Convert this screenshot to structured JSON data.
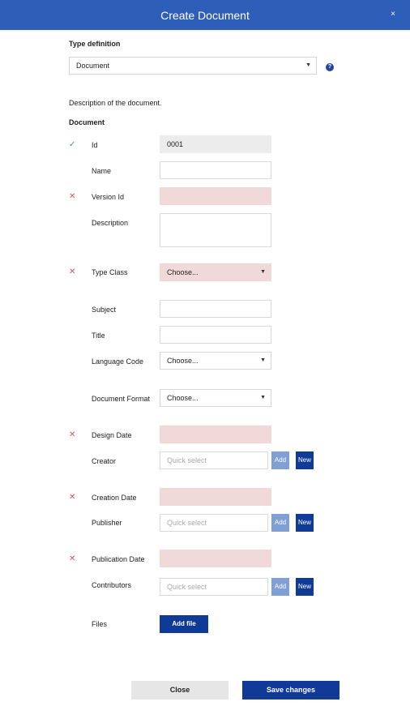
{
  "dialog": {
    "title": "Create Document",
    "close_glyph": "×"
  },
  "type_definition": {
    "label": "Type definition",
    "selected": "Document",
    "help_glyph": "?"
  },
  "description_text": "Description of the document.",
  "section_title": "Document",
  "fields": {
    "id": {
      "label": "Id",
      "value": "0001",
      "status": "valid",
      "status_glyph": "✓"
    },
    "name": {
      "label": "Name",
      "value": ""
    },
    "version_id": {
      "label": "Version Id",
      "value": "",
      "status": "invalid",
      "status_glyph": "✕"
    },
    "description": {
      "label": "Description",
      "value": ""
    },
    "type_class": {
      "label": "Type Class",
      "selected": "Choose...",
      "status": "invalid",
      "status_glyph": "✕"
    },
    "subject": {
      "label": "Subject",
      "value": ""
    },
    "title": {
      "label": "Title",
      "value": ""
    },
    "language_code": {
      "label": "Language Code",
      "selected": "Choose..."
    },
    "document_format": {
      "label": "Document Format",
      "selected": "Choose..."
    },
    "design_date": {
      "label": "Design Date",
      "value": "",
      "status": "invalid",
      "status_glyph": "✕"
    },
    "creator": {
      "label": "Creator",
      "placeholder": "Quick select",
      "add_label": "Add",
      "new_label": "New"
    },
    "creation_date": {
      "label": "Creation Date",
      "value": "",
      "status": "invalid",
      "status_glyph": "✕"
    },
    "publisher": {
      "label": "Publisher",
      "placeholder": "Quick select",
      "add_label": "Add",
      "new_label": "New"
    },
    "publication_date": {
      "label": "Publication Date",
      "value": "",
      "status": "invalid",
      "status_glyph": "✕"
    },
    "contributors": {
      "label": "Contributors",
      "placeholder": "Quick select",
      "add_label": "Add",
      "new_label": "New"
    },
    "files": {
      "label": "Files",
      "button_label": "Add file"
    }
  },
  "footer": {
    "close_label": "Close",
    "save_label": "Save changes"
  },
  "dropdown_caret": "▼",
  "colors": {
    "header": "#2f5eb8",
    "primary": "#0f3a97",
    "secondary_button": "#7f9fd6",
    "invalid_field": "#f2d9d9",
    "invalid_mark": "#d9534f",
    "valid_mark": "#3aa35b"
  }
}
